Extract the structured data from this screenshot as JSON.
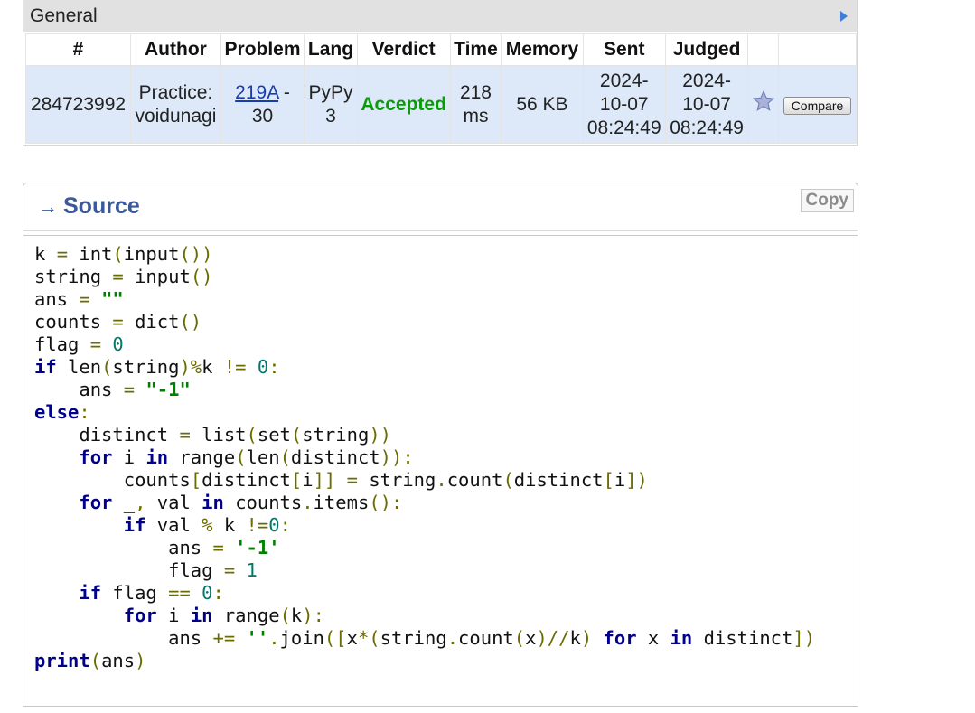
{
  "general": {
    "title": "General",
    "columns": [
      "#",
      "Author",
      "Problem",
      "Lang",
      "Verdict",
      "Time",
      "Memory",
      "Sent",
      "Judged"
    ],
    "submission": {
      "id": "284723992",
      "author_line1": "Practice:",
      "author_line2": "voidunagi",
      "problem_link": "219A",
      "problem_rest_line1": " -",
      "problem_rest_line2": "30",
      "lang_line1": "PyPy",
      "lang_line2": "3",
      "verdict": "Accepted",
      "time_line1": "218",
      "time_line2": "ms",
      "memory": "56 KB",
      "sent_line1": "2024-",
      "sent_line2": "10-07",
      "sent_line3": "08:24:49",
      "judged_line1": "2024-",
      "judged_line2": "10-07",
      "judged_line3": "08:24:49",
      "compare_label": "Compare"
    }
  },
  "source": {
    "title": "Source",
    "copy_label": "Copy",
    "code_lines": [
      "k = int(input())",
      "string = input()",
      "ans = \"\"",
      "counts = dict()",
      "flag = 0",
      "if len(string)%k != 0:",
      "    ans = \"-1\"",
      "else:",
      "    distinct = list(set(string))",
      "    for i in range(len(distinct)):",
      "        counts[distinct[i]] = string.count(distinct[i])",
      "    for _, val in counts.items():",
      "        if val % k !=0:",
      "            ans = '-1'",
      "            flag = 1",
      "    if flag == 0:",
      "        for i in range(k):",
      "            ans += ''.join([x*(string.count(x)//k) for x in distinct])",
      "print(ans)"
    ]
  },
  "colors": {
    "accepted": "#0a9a0a",
    "row_highlight": "#dde9f8",
    "link": "#1a3cad",
    "source_title": "#3b5998"
  }
}
